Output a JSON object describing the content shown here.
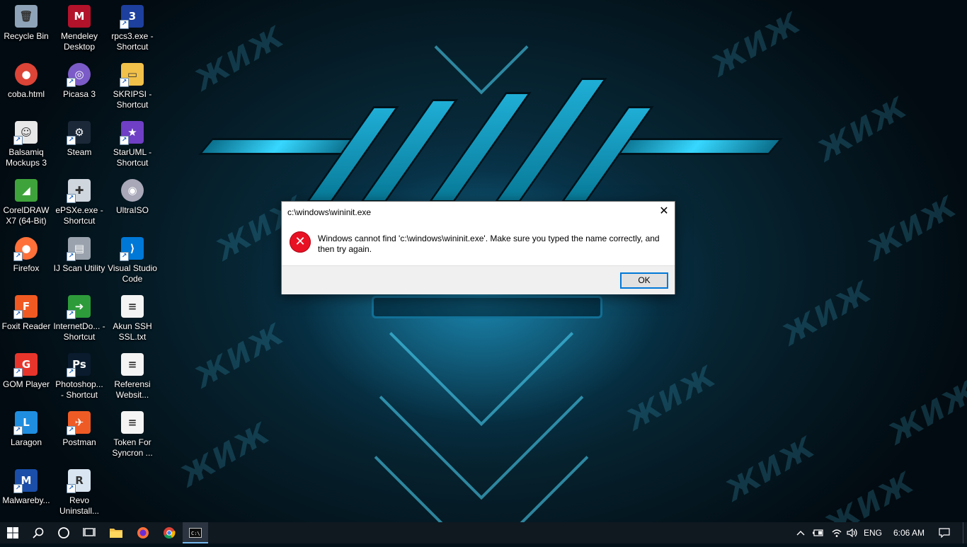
{
  "desktop": {
    "icons": [
      {
        "label": "Recycle Bin",
        "icon": "recycle-bin-icon"
      },
      {
        "label": "Mendeley Desktop",
        "icon": "mendeley-icon"
      },
      {
        "label": "rpcs3.exe - Shortcut",
        "icon": "rpcs3-icon"
      },
      {
        "label": "coba.html",
        "icon": "chrome-html-icon"
      },
      {
        "label": "Picasa 3",
        "icon": "picasa-icon"
      },
      {
        "label": "SKRIPSI - Shortcut",
        "icon": "folder-shortcut-icon"
      },
      {
        "label": "Balsamiq Mockups 3",
        "icon": "balsamiq-icon"
      },
      {
        "label": "Steam",
        "icon": "steam-icon"
      },
      {
        "label": "StarUML - Shortcut",
        "icon": "staruml-icon"
      },
      {
        "label": "CorelDRAW X7 (64-Bit)",
        "icon": "coreldraw-icon"
      },
      {
        "label": "ePSXe.exe - Shortcut",
        "icon": "gamepad-icon"
      },
      {
        "label": "UltraISO",
        "icon": "disc-icon"
      },
      {
        "label": "Firefox",
        "icon": "firefox-icon"
      },
      {
        "label": "IJ Scan Utility",
        "icon": "scanner-icon"
      },
      {
        "label": "Visual Studio Code",
        "icon": "vscode-icon"
      },
      {
        "label": "Foxit Reader",
        "icon": "foxit-icon"
      },
      {
        "label": "InternetDo... - Shortcut",
        "icon": "idm-icon"
      },
      {
        "label": "Akun SSH SSL.txt",
        "icon": "text-file-icon"
      },
      {
        "label": "GOM Player",
        "icon": "gom-player-icon"
      },
      {
        "label": "Photoshop... - Shortcut",
        "icon": "photoshop-icon"
      },
      {
        "label": "Referensi Websit...",
        "icon": "text-file-icon"
      },
      {
        "label": "Laragon",
        "icon": "laragon-icon"
      },
      {
        "label": "Postman",
        "icon": "postman-icon"
      },
      {
        "label": "Token For Syncron ...",
        "icon": "text-file-icon"
      },
      {
        "label": "Malwareby...",
        "icon": "malwarebytes-icon"
      },
      {
        "label": "Revo Uninstall...",
        "icon": "revo-icon"
      }
    ]
  },
  "dialog": {
    "title": "c:\\windows\\wininit.exe",
    "message": "Windows cannot find 'c:\\windows\\wininit.exe'. Make sure you typed the name correctly, and then try again.",
    "ok_label": "OK",
    "icon": "error-icon"
  },
  "taskbar": {
    "pinned": [
      "start-icon",
      "search-icon",
      "cortana-icon",
      "task-view-icon",
      "file-explorer-icon",
      "firefox-icon",
      "chrome-icon",
      "cmd-icon"
    ],
    "language": "ENG",
    "time": "6:06 AM"
  },
  "colors": {
    "accent": "#0078d7",
    "error": "#e81123",
    "taskbar": "#101820"
  }
}
